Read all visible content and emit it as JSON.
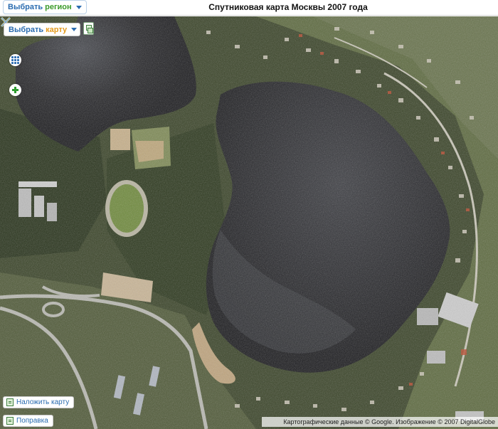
{
  "header": {
    "title": "Спутниковая карта Москвы 2007 года",
    "region_button": {
      "word1": "Выбрать",
      "word2": "регион",
      "icon": "chevron-down-icon"
    }
  },
  "map_controls": {
    "map_select": {
      "word1": "Выбрать",
      "word2": "карту",
      "icon": "chevron-down-icon"
    },
    "layers_icon": "layers-icon",
    "grid_icon": "grid-icon",
    "zoom_icon": "plus-icon",
    "overlay_button": {
      "label": "Наложить карту",
      "icon": "map-layer-icon"
    },
    "fix_button": {
      "label": "Поправка",
      "icon": "edit-icon"
    }
  },
  "map": {
    "copyright": "Картографические данные © Google. Изображение © 2007 DigitalGlobe",
    "marker_icon": "location-crosshair-icon",
    "colors": {
      "water": "#1f1f22",
      "forest": "#2e3a1e",
      "field": "#7b8a4d",
      "sand": "#c7ad86",
      "road": "#b9b9b2",
      "accent": "#2b6cb0",
      "accent_green": "#3a9a2a",
      "accent_orange": "#e39a1c"
    }
  }
}
